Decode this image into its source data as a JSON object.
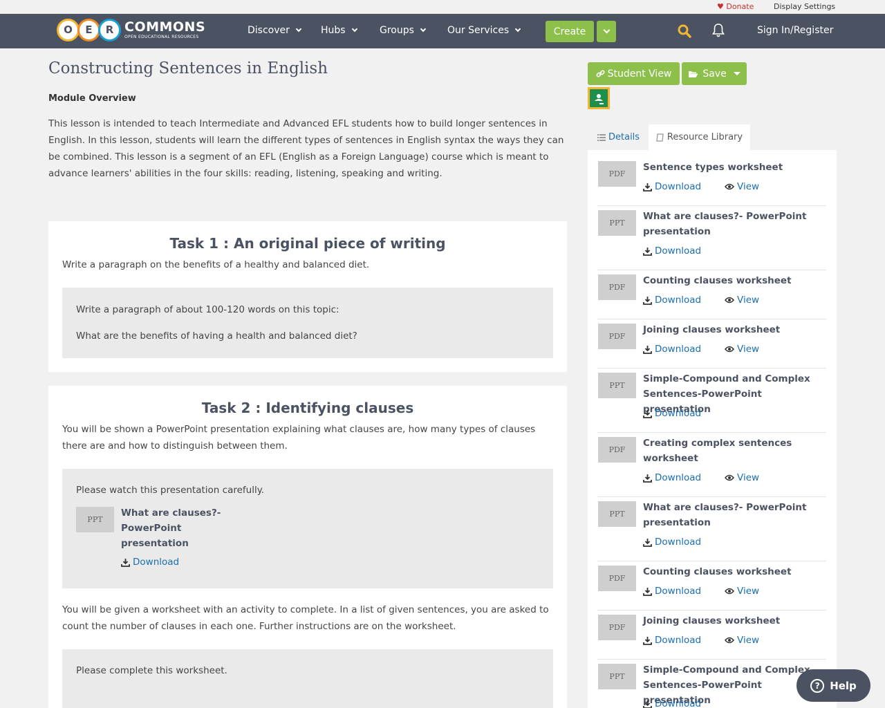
{
  "utility": {
    "donate": "Donate",
    "display_settings": "Display Settings"
  },
  "logo": {
    "o": "O",
    "e": "E",
    "r": "R",
    "name": "COMMONS",
    "tagline": "OPEN EDUCATIONAL RESOURCES"
  },
  "nav": {
    "discover": "Discover",
    "hubs": "Hubs",
    "groups": "Groups",
    "services": "Our Services",
    "create": "Create",
    "signin": "Sign In/Register"
  },
  "page": {
    "title": "Constructing Sentences in English",
    "module_label": "Module Overview",
    "overview": "This lesson is intended to teach Intermediate and Advanced EFL students how to build longer sentences in English. In this lesson, students will learn the different types of sentences in English syntax the ways they can be combined. This lesson is a segment of an EFL (English as a Foreign Language) course which is meant to advance learners' abilities in the four skills: reading, listening, speaking and writing."
  },
  "task1": {
    "title": "Task 1 : An original piece of writing",
    "text": "Write a paragraph on the benefits of a healthy and balanced diet.",
    "box_line1": "Write a paragraph of about 100-120 words on this topic:",
    "box_line2": "What are the benefits of having a health and balanced diet?"
  },
  "task2": {
    "title": "Task 2 : Identifying clauses",
    "text": "You will be shown a PowerPoint presentation explaining what clauses are, how many types of clauses there are and how to distinguish between them.",
    "box_text": "Please watch this presentation carefully.",
    "resource": {
      "type": "PPT",
      "title": "What are clauses?- PowerPoint presentation",
      "download": "Download"
    },
    "text2": "You will be given a worksheet with an activity to complete. In a list of given sentences, you are asked to count the number of clauses in each one. Further instructions are on the worksheet.",
    "box2_text": "Please complete this worksheet."
  },
  "sidebar": {
    "student_view": "Student View",
    "save": "Save",
    "tab_details": "Details",
    "tab_library": "Resource Library",
    "download": "Download",
    "view": "View",
    "items": [
      {
        "type": "PDF",
        "title": "Sentence types worksheet"
      },
      {
        "type": "PPT",
        "title": "What are clauses?- PowerPoint presentation"
      },
      {
        "type": "PDF",
        "title": "Counting clauses worksheet"
      },
      {
        "type": "PDF",
        "title": "Joining clauses worksheet"
      },
      {
        "type": "PPT",
        "title": "Simple-Compound and Complex Sentences-PowerPoint presentation"
      },
      {
        "type": "PDF",
        "title": "Creating complex sentences worksheet"
      },
      {
        "type": "PPT",
        "title": "What are clauses?- PowerPoint presentation"
      },
      {
        "type": "PDF",
        "title": "Counting clauses worksheet"
      },
      {
        "type": "PDF",
        "title": "Joining clauses worksheet"
      },
      {
        "type": "PPT",
        "title": "Simple-Compound and Complex Sentences-PowerPoint presentation"
      }
    ]
  },
  "help": {
    "label": "Help"
  },
  "colors": {
    "nav_bg": "#4b5262",
    "accent_green": "#8cc04b",
    "link_blue": "#1a6eaf",
    "donate_red": "#c9302c"
  }
}
